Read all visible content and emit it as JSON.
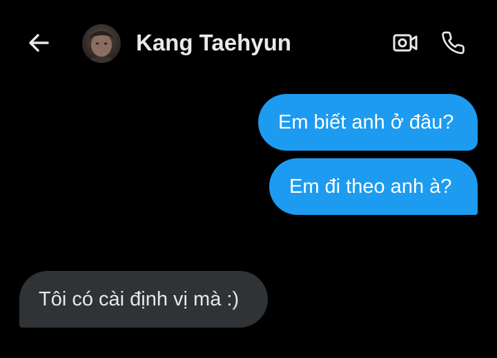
{
  "header": {
    "contact_name": "Kang Taehyun",
    "back_icon": "arrow-left-icon",
    "video_icon": "video-camera-icon",
    "call_icon": "phone-icon"
  },
  "messages": [
    {
      "direction": "sent",
      "text": "Em biết anh ở đâu?"
    },
    {
      "direction": "sent",
      "text": "Em đi theo anh à?"
    },
    {
      "direction": "received",
      "text": "Tôi có cài định vị mà :)"
    }
  ],
  "colors": {
    "background": "#000000",
    "sent_bubble": "#1d9bf0",
    "received_bubble": "#2f3336",
    "text": "#e7e9ea"
  }
}
